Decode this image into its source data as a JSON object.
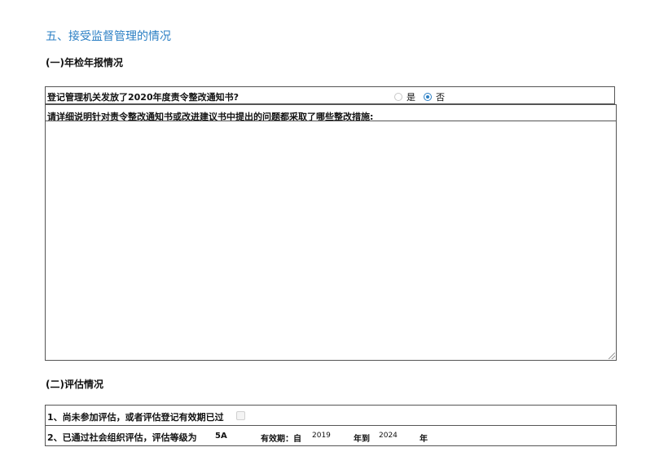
{
  "section": {
    "title": "五、接受监督管理的情况"
  },
  "annual": {
    "title": "(一)年检年报情况",
    "question": "登记管理机关发放了2020年度责令整改通知书?",
    "options": [
      "是",
      "否"
    ],
    "selected": "否",
    "detail_prompt": "请详细说明针对责令整改通知书或改进建议书中提出的问题都采取了哪些整改措施:"
  },
  "evaluation": {
    "title": "(二)评估情况",
    "row1": {
      "label": "1、尚未参加评估，或者评估登记有效期已过",
      "checked": false
    },
    "row2": {
      "label": "2、已通过社会组织评估，评估等级为",
      "grade": "5A",
      "validity_label": "有效期：自",
      "year_from": "2019",
      "to_label": "年到",
      "year_to": "2024",
      "year_suffix": "年"
    }
  },
  "colors": {
    "accent": "#2b7fc4",
    "border": "#555555"
  }
}
